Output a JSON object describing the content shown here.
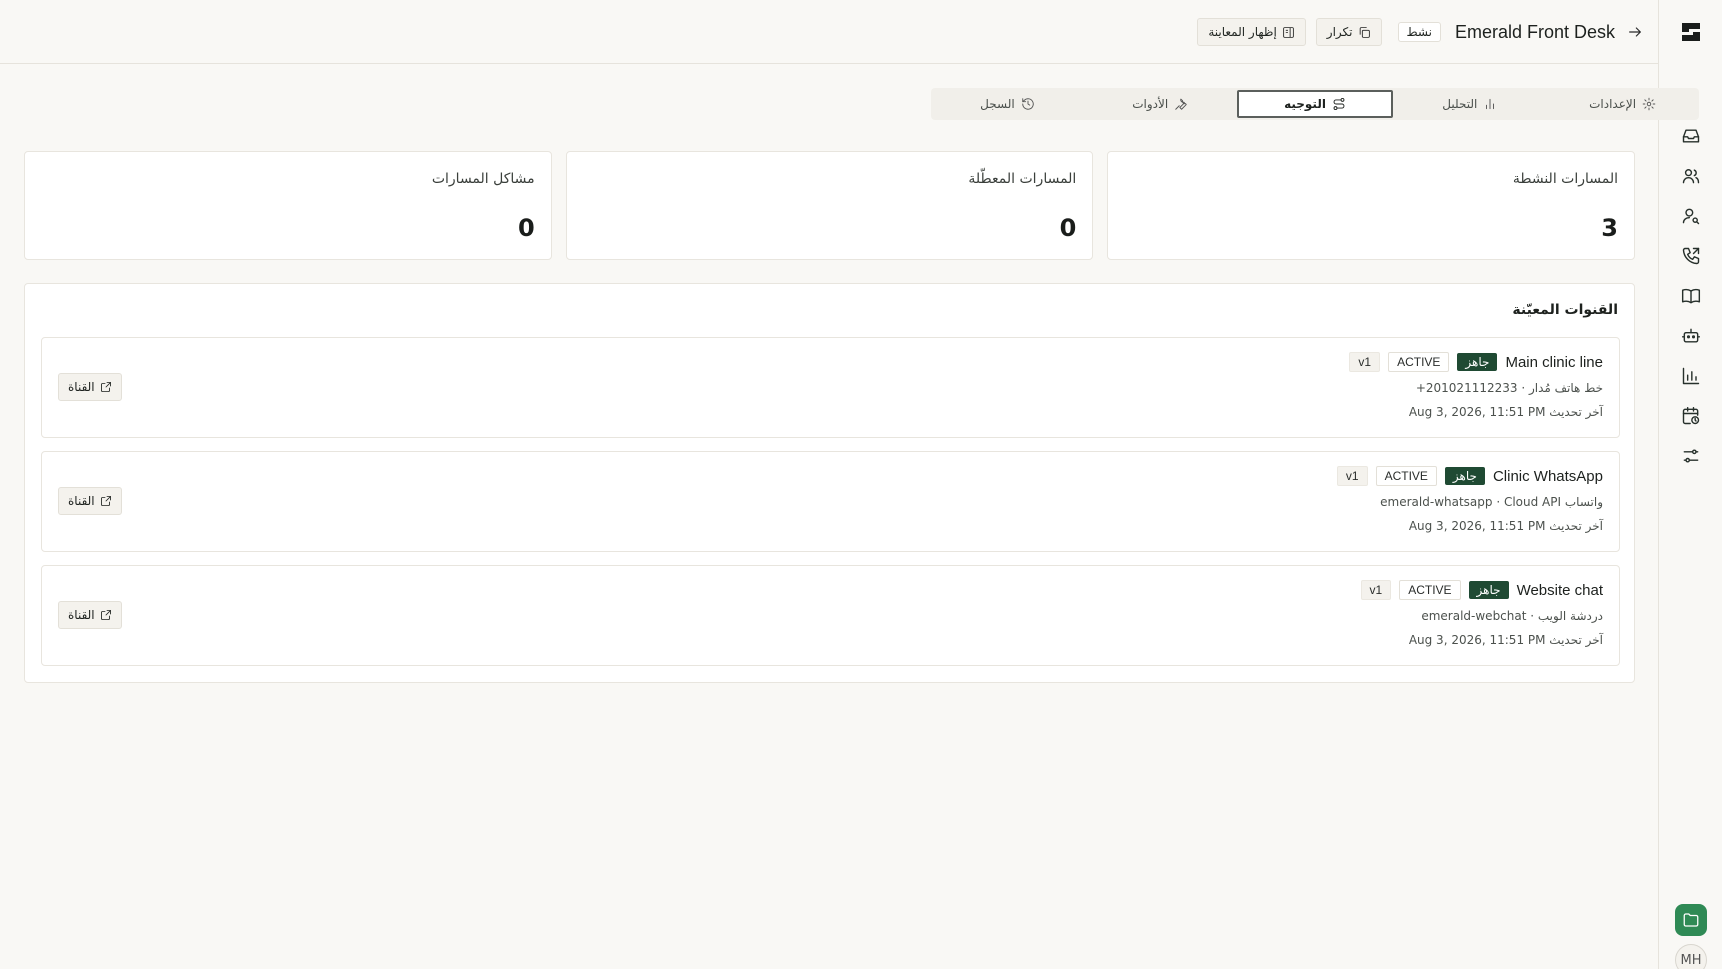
{
  "header": {
    "title": "Emerald Front Desk",
    "status": "نشط",
    "duplicate_label": "تكرار",
    "preview_label": "إظهار المعاينة"
  },
  "tabs": [
    {
      "label": "الإعدادات",
      "icon": "gear-icon"
    },
    {
      "label": "التحليل",
      "icon": "bar-chart-icon"
    },
    {
      "label": "التوجيه",
      "icon": "route-icon",
      "active": true
    },
    {
      "label": "الأدوات",
      "icon": "wrench-icon"
    },
    {
      "label": "السجل",
      "icon": "history-icon"
    }
  ],
  "stats": [
    {
      "label": "المسارات النشطة",
      "value": "3"
    },
    {
      "label": "المسارات المعطّلة",
      "value": "0"
    },
    {
      "label": "مشاكل المسارات",
      "value": "0"
    }
  ],
  "channels": {
    "title": "القنوات المعيّنة",
    "open_label": "القناة",
    "items": [
      {
        "name": "Main clinic line",
        "ready": "جاهز",
        "state": "ACTIVE",
        "version": "v1",
        "subtitle": "خط هاتف مُدار · 201021112233+",
        "updated": "آخر تحديث Aug 3, 2026, 11:51 PM"
      },
      {
        "name": "Clinic WhatsApp",
        "ready": "جاهز",
        "state": "ACTIVE",
        "version": "v1",
        "subtitle": "واتساب emerald-whatsapp · Cloud API",
        "updated": "آخر تحديث Aug 3, 2026, 11:51 PM"
      },
      {
        "name": "Website chat",
        "ready": "جاهز",
        "state": "ACTIVE",
        "version": "v1",
        "subtitle": "دردشة الويب · emerald-webchat",
        "updated": "آخر تحديث Aug 3, 2026, 11:51 PM"
      }
    ]
  },
  "rail": {
    "items": [
      "gauge-icon",
      "inbox-icon",
      "users-icon",
      "user-search-icon",
      "phone-icon",
      "book-icon",
      "bot-icon",
      "chart-icon",
      "calendar-clock-icon",
      "sliders-icon"
    ],
    "avatar_initials": "MH"
  },
  "colors": {
    "accent": "#2f8a55",
    "ready_badge": "#1f4a33",
    "background": "#f9f8f5"
  }
}
